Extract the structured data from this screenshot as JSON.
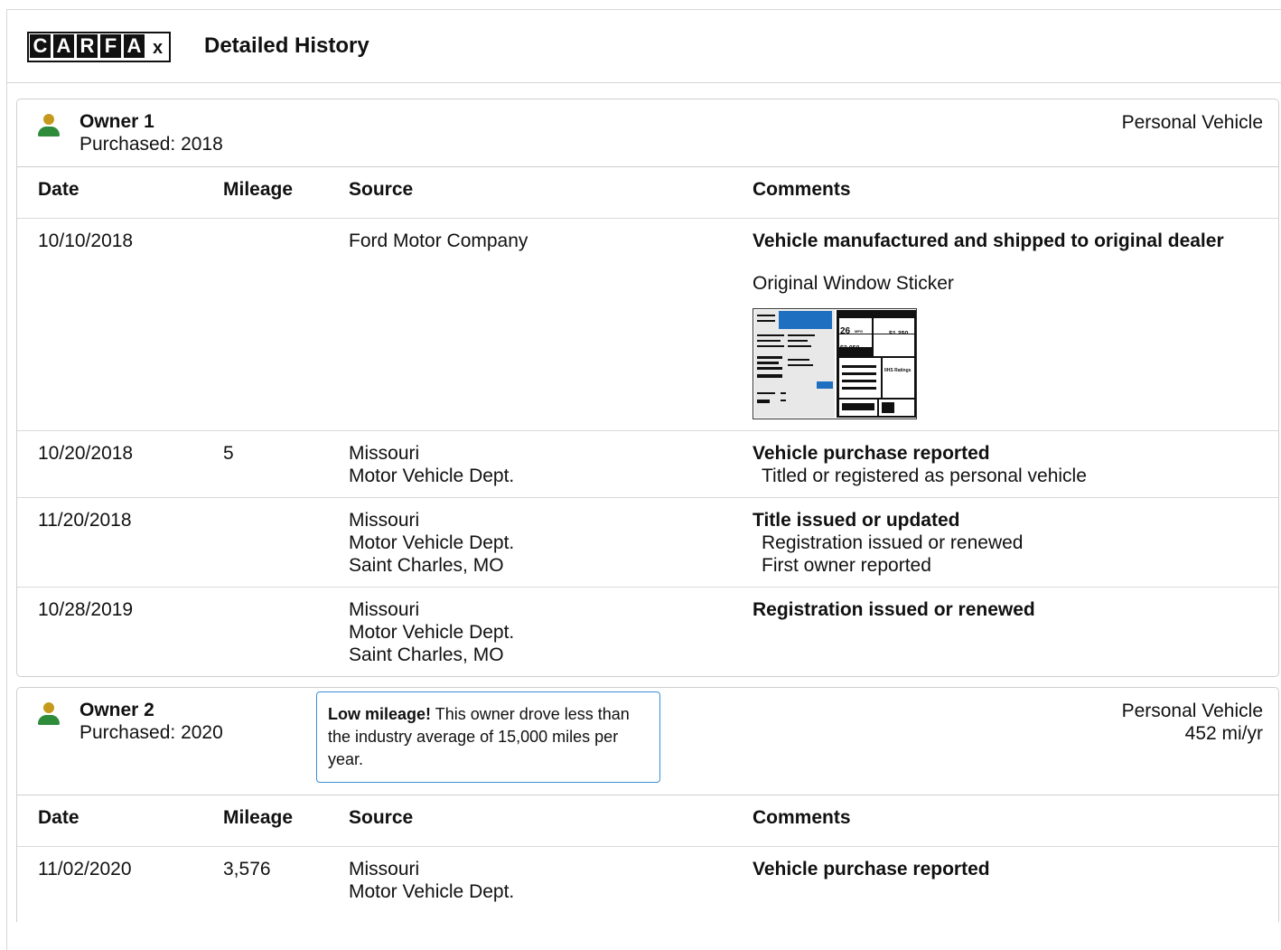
{
  "header": {
    "logo_letters": [
      "C",
      "A",
      "R",
      "F",
      "A",
      "x"
    ],
    "title": "Detailed History"
  },
  "columns": {
    "date": "Date",
    "mileage": "Mileage",
    "source": "Source",
    "comments": "Comments"
  },
  "owners": [
    {
      "name": "Owner 1",
      "purchased": "Purchased: 2018",
      "type": "Personal Vehicle",
      "rows": [
        {
          "date": "10/10/2018",
          "mileage": "",
          "source": [
            "Ford Motor Company"
          ],
          "comment_title": "Vehicle manufactured and shipped to original dealer",
          "comment_lines": [],
          "sticker_label": "Original Window Sticker",
          "sticker_text": {
            "mpg": "26",
            "mpg_unit": "MPG",
            "price": "$1,350",
            "cost": "$2,050",
            "ratings": "IIHS Ratings"
          }
        },
        {
          "date": "10/20/2018",
          "mileage": "5",
          "source": [
            "Missouri",
            "Motor Vehicle Dept."
          ],
          "comment_title": "Vehicle purchase reported",
          "comment_lines": [
            "Titled or registered as personal vehicle"
          ]
        },
        {
          "date": "11/20/2018",
          "mileage": "",
          "source": [
            "Missouri",
            "Motor Vehicle Dept.",
            "Saint Charles, MO"
          ],
          "comment_title": "Title issued or updated",
          "comment_lines": [
            "Registration issued or renewed",
            "First owner reported"
          ]
        },
        {
          "date": "10/28/2019",
          "mileage": "",
          "source": [
            "Missouri",
            "Motor Vehicle Dept.",
            "Saint Charles, MO"
          ],
          "comment_title": "Registration issued or renewed",
          "comment_lines": []
        }
      ]
    },
    {
      "name": "Owner 2",
      "purchased": "Purchased: 2020",
      "type": "Personal Vehicle",
      "rate": "452 mi/yr",
      "callout": {
        "bold": "Low mileage!",
        "text": " This owner drove less than the industry average of 15,000 miles per year."
      },
      "rows": [
        {
          "date": "11/02/2020",
          "mileage": "3,576",
          "source": [
            "Missouri",
            "Motor Vehicle Dept."
          ],
          "comment_title": "Vehicle purchase reported",
          "comment_lines": []
        }
      ]
    }
  ],
  "colors": {
    "person_head": "#c59a1c",
    "person_body": "#2e8b3a",
    "callout_border": "#3a8fd9",
    "sticker_blue": "#1f6fc0"
  }
}
